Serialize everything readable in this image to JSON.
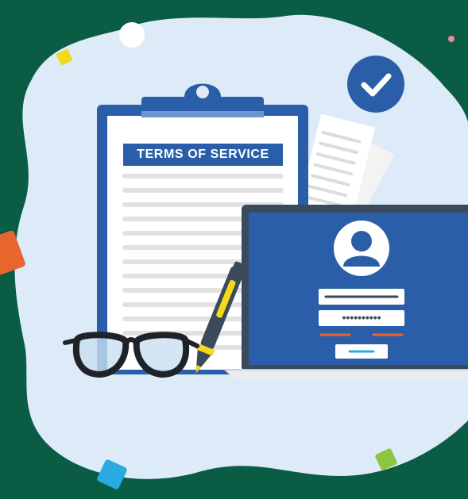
{
  "document": {
    "title": "TERMS OF SERVICE"
  },
  "login_form": {
    "password_mask": "••••••••••"
  },
  "colors": {
    "background": "#0a5c45",
    "blob": "#dcebf7",
    "accent_blue": "#2a5ea8",
    "check_badge": "#2a5ea8",
    "laptop_frame": "#3b4a5a",
    "laptop_screen": "#2a5ea8",
    "orange": "#e8652e",
    "yellow": "#f4d81a",
    "green": "#8cc63f",
    "sky": "#29abe2",
    "pink": "#f08aa0"
  },
  "icons": [
    "check-icon",
    "user-avatar-icon",
    "glasses-icon",
    "pen-icon",
    "clipboard-clip-icon"
  ]
}
